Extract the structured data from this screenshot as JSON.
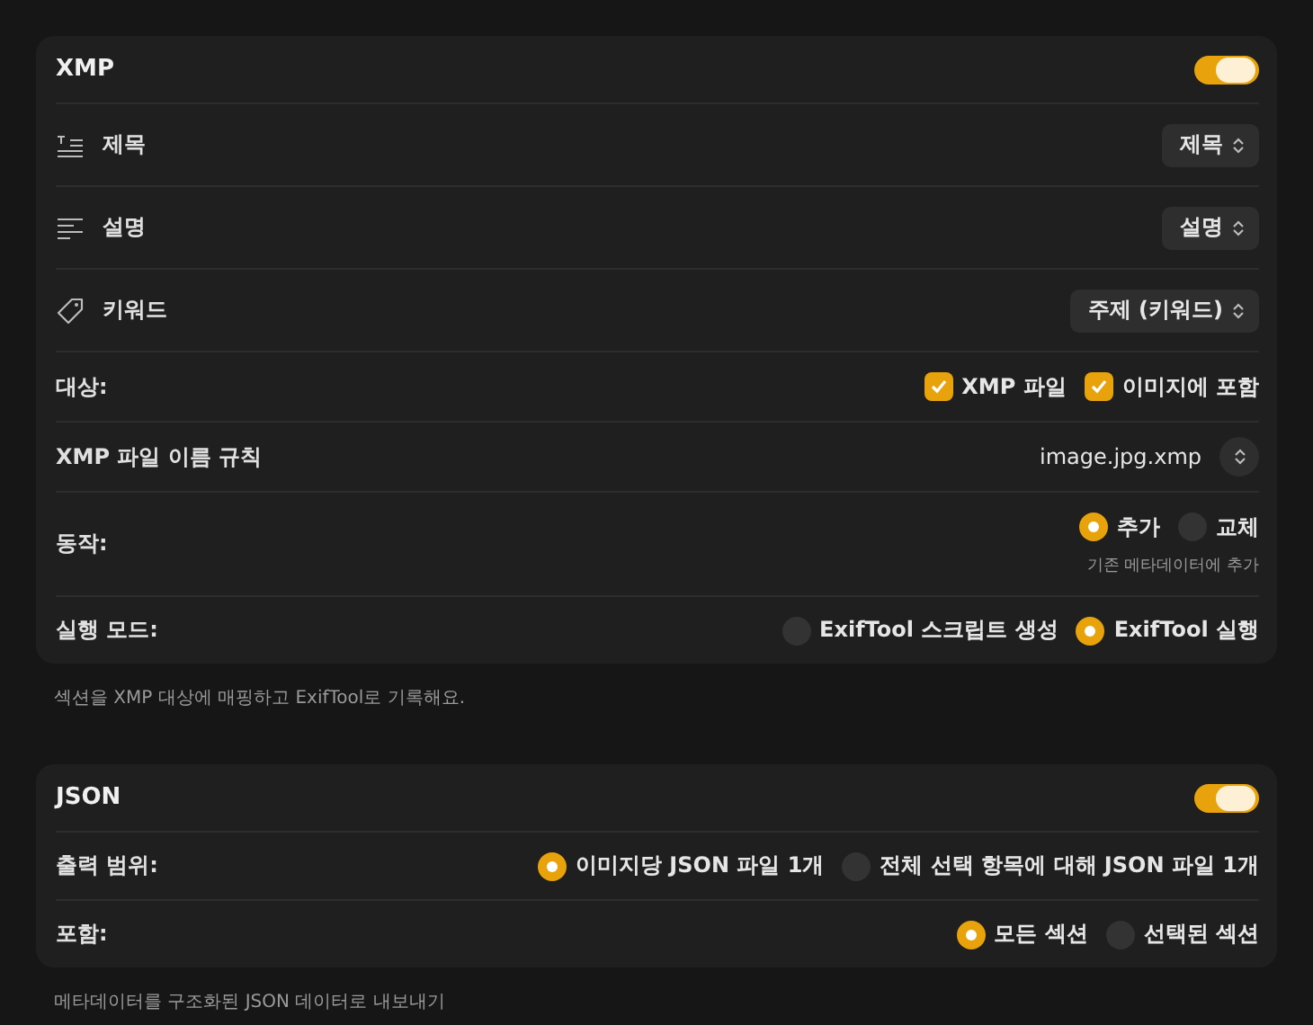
{
  "sections": [
    {
      "title": "XMP",
      "enabled": true,
      "footnote": "섹션을 XMP 대상에 매핑하고 ExifTool로 기록해요.",
      "rows": [
        {
          "kind": "select",
          "label": "제목",
          "value": "제목"
        },
        {
          "kind": "select",
          "label": "설명",
          "value": "설명"
        },
        {
          "kind": "select",
          "label": "키워드",
          "value": "주제 (키워드)"
        },
        {
          "kind": "checkboxes",
          "label": "대상:",
          "options": [
            {
              "label": "XMP 파일",
              "checked": true
            },
            {
              "label": "이미지에 포함",
              "checked": true
            }
          ]
        },
        {
          "kind": "stepper",
          "label": "XMP 파일 이름 규칙",
          "value": "image.jpg.xmp"
        },
        {
          "kind": "radios",
          "label": "동작:",
          "options": [
            {
              "label": "추가",
              "selected": true
            },
            {
              "label": "교체",
              "selected": false
            }
          ],
          "note": "기존 메타데이터에 추가"
        },
        {
          "kind": "radios",
          "label": "실행 모드:",
          "options": [
            {
              "label": "ExifTool 스크립트 생성",
              "selected": false
            },
            {
              "label": "ExifTool 실행",
              "selected": true
            }
          ]
        }
      ]
    },
    {
      "title": "JSON",
      "enabled": true,
      "footnote": "메타데이터를 구조화된 JSON 데이터로 내보내기",
      "rows": [
        {
          "kind": "radios",
          "label": "출력 범위:",
          "options": [
            {
              "label": "이미지당 JSON 파일 1개",
              "selected": true
            },
            {
              "label": "전체 선택 항목에 대해 JSON 파일 1개",
              "selected": false
            }
          ]
        },
        {
          "kind": "radios",
          "label": "포함:",
          "options": [
            {
              "label": "모든 섹션",
              "selected": true
            },
            {
              "label": "선택된 섹션",
              "selected": false
            }
          ]
        }
      ]
    }
  ]
}
